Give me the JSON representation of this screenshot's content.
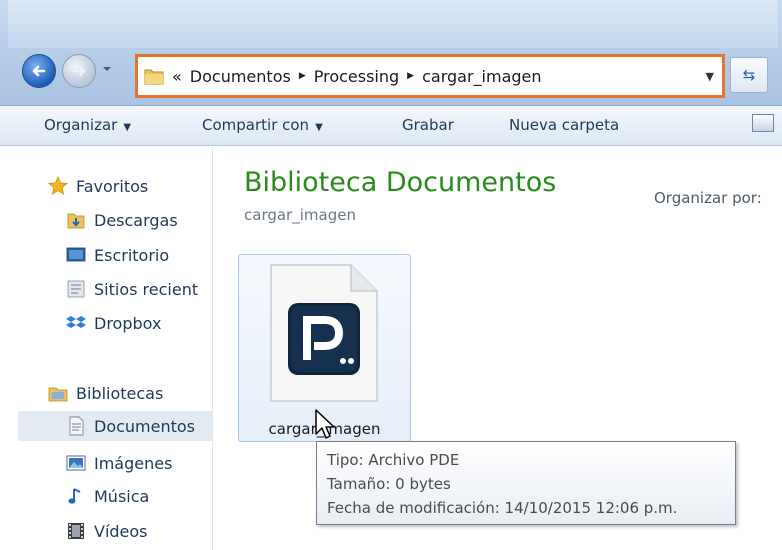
{
  "address": {
    "overflow": "«",
    "crumbs": [
      "Documentos",
      "Processing",
      "cargar_imagen"
    ]
  },
  "toolbar": {
    "organize": "Organizar",
    "share": "Compartir con",
    "burn": "Grabar",
    "new_folder": "Nueva carpeta"
  },
  "sidebar": {
    "favorites": "Favoritos",
    "downloads": "Descargas",
    "desktop": "Escritorio",
    "recent": "Sitios recient",
    "dropbox": "Dropbox",
    "libraries": "Bibliotecas",
    "documents": "Documentos",
    "images": "Imágenes",
    "music": "Música",
    "videos": "Vídeos"
  },
  "main": {
    "title": "Biblioteca Documentos",
    "subtitle": "cargar_imagen",
    "sort_label": "Organizar por:",
    "file_name": "cargar_imagen"
  },
  "tooltip": {
    "type": "Tipo: Archivo PDE",
    "size": "Tamaño: 0 bytes",
    "modified": "Fecha de modificación: 14/10/2015 12:06 p.m."
  },
  "colors": {
    "highlight_border": "#e8742c",
    "title_green": "#2b8a1e",
    "nav_text": "#1e395b"
  },
  "icons": {
    "back": "back-arrow-icon",
    "forward": "forward-arrow-icon",
    "refresh": "refresh-icon",
    "file": "processing-file-icon"
  }
}
